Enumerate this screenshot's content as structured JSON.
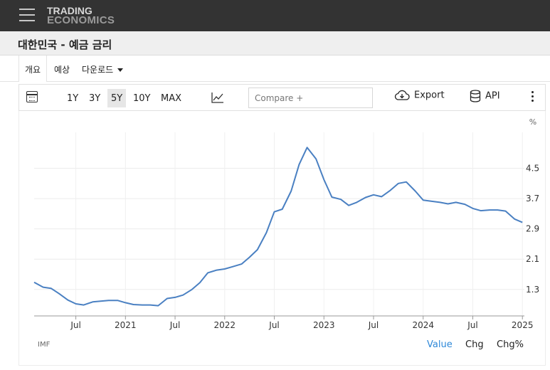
{
  "header": {
    "logo_line1": "TRADING",
    "logo_line2": "ECONOMICS",
    "menu_icon": "hamburger-menu-icon"
  },
  "page": {
    "title": "대한민국 - 예금 금리"
  },
  "tabs": {
    "overview": "개요",
    "forecast": "예상",
    "download": "다운로드"
  },
  "toolbar": {
    "calendar_icon": "calendar-icon",
    "ranges": [
      "1Y",
      "3Y",
      "5Y",
      "10Y",
      "MAX"
    ],
    "selected_range": "5Y",
    "chart_type_icon": "line-chart-icon",
    "compare_placeholder": "Compare +",
    "export_label": "Export",
    "api_label": "API",
    "more_icon": "more-vertical-icon"
  },
  "footer": {
    "source": "IMF",
    "value_label": "Value",
    "chg_label": "Chg",
    "chgpct_label": "Chg%"
  },
  "colors": {
    "line": "#4a80c2",
    "active_mode": "#2e88d8"
  },
  "chart_data": {
    "type": "line",
    "unit_label": "%",
    "y_ticks": [
      1.3,
      2.1,
      2.9,
      3.7,
      4.5
    ],
    "ylim": [
      0.6,
      5.45
    ],
    "x_ticks": [
      {
        "label": "Jul",
        "x": 2020.5
      },
      {
        "label": "2021",
        "x": 2021.0
      },
      {
        "label": "Jul",
        "x": 2021.5
      },
      {
        "label": "2022",
        "x": 2022.0
      },
      {
        "label": "Jul",
        "x": 2022.5
      },
      {
        "label": "2023",
        "x": 2023.0
      },
      {
        "label": "Jul",
        "x": 2023.5
      },
      {
        "label": "2024",
        "x": 2024.0
      },
      {
        "label": "Jul",
        "x": 2024.5
      },
      {
        "label": "2025",
        "x": 2025.0
      }
    ],
    "xlim": [
      2020.08,
      2025.02
    ],
    "grid": true,
    "series": [
      {
        "points": [
          [
            2020.08,
            1.49
          ],
          [
            2020.17,
            1.36
          ],
          [
            2020.25,
            1.33
          ],
          [
            2020.33,
            1.19
          ],
          [
            2020.42,
            1.02
          ],
          [
            2020.5,
            0.92
          ],
          [
            2020.58,
            0.89
          ],
          [
            2020.67,
            0.97
          ],
          [
            2020.75,
            0.99
          ],
          [
            2020.83,
            1.01
          ],
          [
            2020.92,
            1.01
          ],
          [
            2021.0,
            0.95
          ],
          [
            2021.08,
            0.9
          ],
          [
            2021.17,
            0.89
          ],
          [
            2021.25,
            0.89
          ],
          [
            2021.33,
            0.87
          ],
          [
            2021.42,
            1.06
          ],
          [
            2021.5,
            1.09
          ],
          [
            2021.58,
            1.15
          ],
          [
            2021.67,
            1.3
          ],
          [
            2021.75,
            1.48
          ],
          [
            2021.83,
            1.74
          ],
          [
            2021.92,
            1.81
          ],
          [
            2022.0,
            1.84
          ],
          [
            2022.08,
            1.9
          ],
          [
            2022.17,
            1.97
          ],
          [
            2022.25,
            2.15
          ],
          [
            2022.33,
            2.35
          ],
          [
            2022.42,
            2.8
          ],
          [
            2022.5,
            3.35
          ],
          [
            2022.58,
            3.42
          ],
          [
            2022.67,
            3.9
          ],
          [
            2022.75,
            4.6
          ],
          [
            2022.83,
            5.05
          ],
          [
            2022.92,
            4.75
          ],
          [
            2023.0,
            4.2
          ],
          [
            2023.08,
            3.74
          ],
          [
            2023.17,
            3.68
          ],
          [
            2023.25,
            3.52
          ],
          [
            2023.33,
            3.6
          ],
          [
            2023.42,
            3.73
          ],
          [
            2023.5,
            3.8
          ],
          [
            2023.58,
            3.75
          ],
          [
            2023.67,
            3.92
          ],
          [
            2023.75,
            4.1
          ],
          [
            2023.83,
            4.14
          ],
          [
            2023.92,
            3.9
          ],
          [
            2024.0,
            3.66
          ],
          [
            2024.08,
            3.63
          ],
          [
            2024.17,
            3.6
          ],
          [
            2024.25,
            3.56
          ],
          [
            2024.33,
            3.6
          ],
          [
            2024.42,
            3.55
          ],
          [
            2024.5,
            3.44
          ],
          [
            2024.58,
            3.38
          ],
          [
            2024.67,
            3.4
          ],
          [
            2024.75,
            3.4
          ],
          [
            2024.83,
            3.37
          ],
          [
            2024.92,
            3.16
          ],
          [
            2025.0,
            3.07
          ]
        ]
      }
    ]
  }
}
